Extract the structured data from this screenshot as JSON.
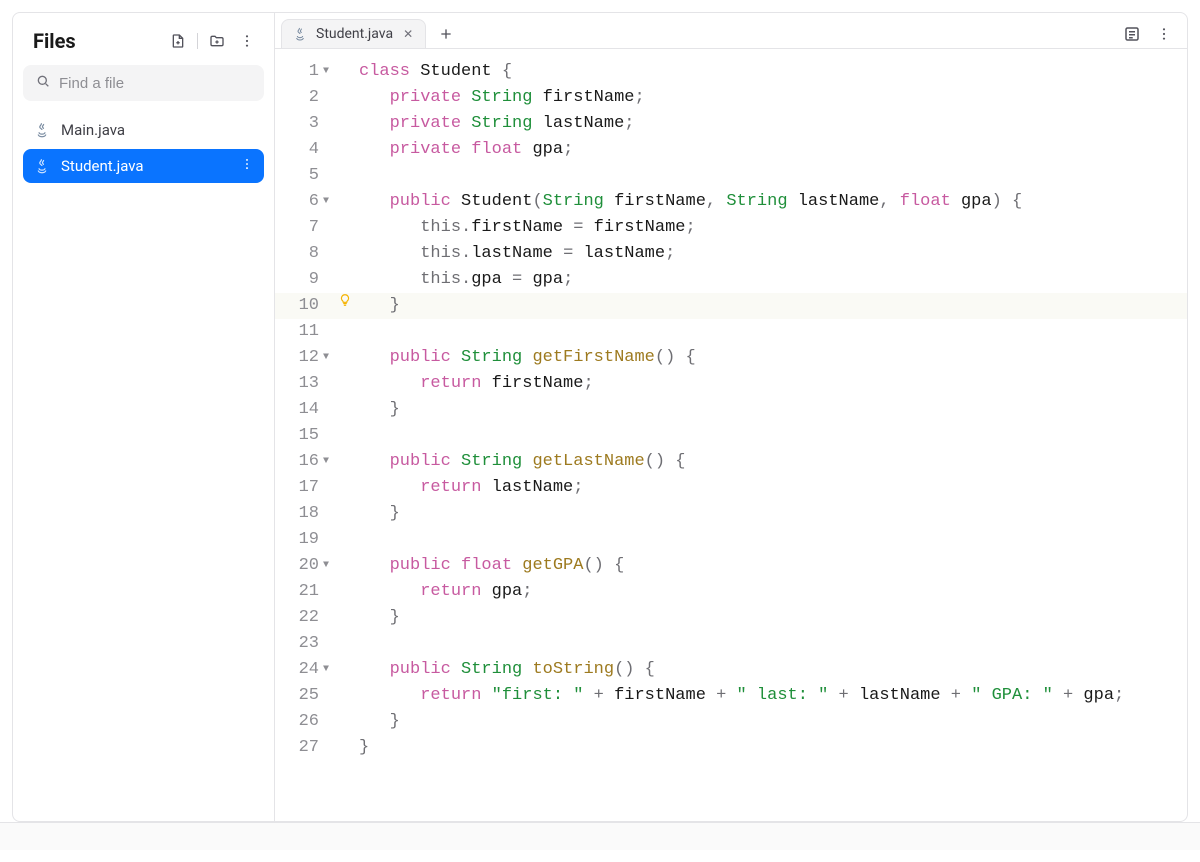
{
  "sidebar": {
    "title": "Files",
    "search_placeholder": "Find a file",
    "files": [
      {
        "name": "Main.java",
        "selected": false
      },
      {
        "name": "Student.java",
        "selected": true
      }
    ]
  },
  "tabs": {
    "open": [
      {
        "label": "Student.java",
        "active": true
      }
    ]
  },
  "editor": {
    "highlighted_line": 10,
    "lines": [
      {
        "n": 1,
        "fold": true,
        "tokens": [
          [
            "kw",
            "class "
          ],
          [
            "plain",
            "Student "
          ],
          [
            "punct",
            "{"
          ]
        ]
      },
      {
        "n": 2,
        "tokens": [
          [
            "plain",
            "   "
          ],
          [
            "kw",
            "private "
          ],
          [
            "type",
            "String "
          ],
          [
            "plain",
            "firstName"
          ],
          [
            "punct",
            ";"
          ]
        ]
      },
      {
        "n": 3,
        "tokens": [
          [
            "plain",
            "   "
          ],
          [
            "kw",
            "private "
          ],
          [
            "type",
            "String "
          ],
          [
            "plain",
            "lastName"
          ],
          [
            "punct",
            ";"
          ]
        ]
      },
      {
        "n": 4,
        "tokens": [
          [
            "plain",
            "   "
          ],
          [
            "kw",
            "private "
          ],
          [
            "kw",
            "float "
          ],
          [
            "plain",
            "gpa"
          ],
          [
            "punct",
            ";"
          ]
        ]
      },
      {
        "n": 5,
        "tokens": [
          [
            "plain",
            ""
          ]
        ]
      },
      {
        "n": 6,
        "fold": true,
        "tokens": [
          [
            "plain",
            "   "
          ],
          [
            "kw",
            "public "
          ],
          [
            "plain",
            "Student"
          ],
          [
            "punct",
            "("
          ],
          [
            "type",
            "String "
          ],
          [
            "plain",
            "firstName"
          ],
          [
            "punct",
            ", "
          ],
          [
            "type",
            "String "
          ],
          [
            "plain",
            "lastName"
          ],
          [
            "punct",
            ", "
          ],
          [
            "kw",
            "float "
          ],
          [
            "plain",
            "gpa"
          ],
          [
            "punct",
            ") {"
          ]
        ]
      },
      {
        "n": 7,
        "tokens": [
          [
            "plain",
            "      "
          ],
          [
            "this",
            "this"
          ],
          [
            "punct",
            "."
          ],
          [
            "plain",
            "firstName "
          ],
          [
            "punct",
            "= "
          ],
          [
            "plain",
            "firstName"
          ],
          [
            "punct",
            ";"
          ]
        ]
      },
      {
        "n": 8,
        "tokens": [
          [
            "plain",
            "      "
          ],
          [
            "this",
            "this"
          ],
          [
            "punct",
            "."
          ],
          [
            "plain",
            "lastName "
          ],
          [
            "punct",
            "= "
          ],
          [
            "plain",
            "lastName"
          ],
          [
            "punct",
            ";"
          ]
        ]
      },
      {
        "n": 9,
        "tokens": [
          [
            "plain",
            "      "
          ],
          [
            "this",
            "this"
          ],
          [
            "punct",
            "."
          ],
          [
            "plain",
            "gpa "
          ],
          [
            "punct",
            "= "
          ],
          [
            "plain",
            "gpa"
          ],
          [
            "punct",
            ";"
          ]
        ]
      },
      {
        "n": 10,
        "bulb": true,
        "tokens": [
          [
            "plain",
            "   "
          ],
          [
            "punct",
            "}"
          ]
        ]
      },
      {
        "n": 11,
        "tokens": [
          [
            "plain",
            ""
          ]
        ]
      },
      {
        "n": 12,
        "fold": true,
        "tokens": [
          [
            "plain",
            "   "
          ],
          [
            "kw",
            "public "
          ],
          [
            "type",
            "String "
          ],
          [
            "ident",
            "getFirstName"
          ],
          [
            "punct",
            "() {"
          ]
        ]
      },
      {
        "n": 13,
        "tokens": [
          [
            "plain",
            "      "
          ],
          [
            "kw",
            "return "
          ],
          [
            "plain",
            "firstName"
          ],
          [
            "punct",
            ";"
          ]
        ]
      },
      {
        "n": 14,
        "tokens": [
          [
            "plain",
            "   "
          ],
          [
            "punct",
            "}"
          ]
        ]
      },
      {
        "n": 15,
        "tokens": [
          [
            "plain",
            ""
          ]
        ]
      },
      {
        "n": 16,
        "fold": true,
        "tokens": [
          [
            "plain",
            "   "
          ],
          [
            "kw",
            "public "
          ],
          [
            "type",
            "String "
          ],
          [
            "ident",
            "getLastName"
          ],
          [
            "punct",
            "() {"
          ]
        ]
      },
      {
        "n": 17,
        "tokens": [
          [
            "plain",
            "      "
          ],
          [
            "kw",
            "return "
          ],
          [
            "plain",
            "lastName"
          ],
          [
            "punct",
            ";"
          ]
        ]
      },
      {
        "n": 18,
        "tokens": [
          [
            "plain",
            "   "
          ],
          [
            "punct",
            "}"
          ]
        ]
      },
      {
        "n": 19,
        "tokens": [
          [
            "plain",
            ""
          ]
        ]
      },
      {
        "n": 20,
        "fold": true,
        "tokens": [
          [
            "plain",
            "   "
          ],
          [
            "kw",
            "public "
          ],
          [
            "kw",
            "float "
          ],
          [
            "ident",
            "getGPA"
          ],
          [
            "punct",
            "() {"
          ]
        ]
      },
      {
        "n": 21,
        "tokens": [
          [
            "plain",
            "      "
          ],
          [
            "kw",
            "return "
          ],
          [
            "plain",
            "gpa"
          ],
          [
            "punct",
            ";"
          ]
        ]
      },
      {
        "n": 22,
        "tokens": [
          [
            "plain",
            "   "
          ],
          [
            "punct",
            "}"
          ]
        ]
      },
      {
        "n": 23,
        "tokens": [
          [
            "plain",
            ""
          ]
        ]
      },
      {
        "n": 24,
        "fold": true,
        "tokens": [
          [
            "plain",
            "   "
          ],
          [
            "kw",
            "public "
          ],
          [
            "type",
            "String "
          ],
          [
            "ident",
            "toString"
          ],
          [
            "punct",
            "() {"
          ]
        ]
      },
      {
        "n": 25,
        "tokens": [
          [
            "plain",
            "      "
          ],
          [
            "kw",
            "return "
          ],
          [
            "str",
            "\"first: \""
          ],
          [
            "punct",
            " + "
          ],
          [
            "plain",
            "firstName"
          ],
          [
            "punct",
            " + "
          ],
          [
            "str",
            "\" last: \""
          ],
          [
            "punct",
            " + "
          ],
          [
            "plain",
            "lastName"
          ],
          [
            "punct",
            " + "
          ],
          [
            "str",
            "\" GPA: \""
          ],
          [
            "punct",
            " + "
          ],
          [
            "plain",
            "gpa"
          ],
          [
            "punct",
            ";"
          ]
        ]
      },
      {
        "n": 26,
        "tokens": [
          [
            "plain",
            "   "
          ],
          [
            "punct",
            "}"
          ]
        ]
      },
      {
        "n": 27,
        "tokens": [
          [
            "punct",
            "}"
          ]
        ]
      }
    ]
  }
}
